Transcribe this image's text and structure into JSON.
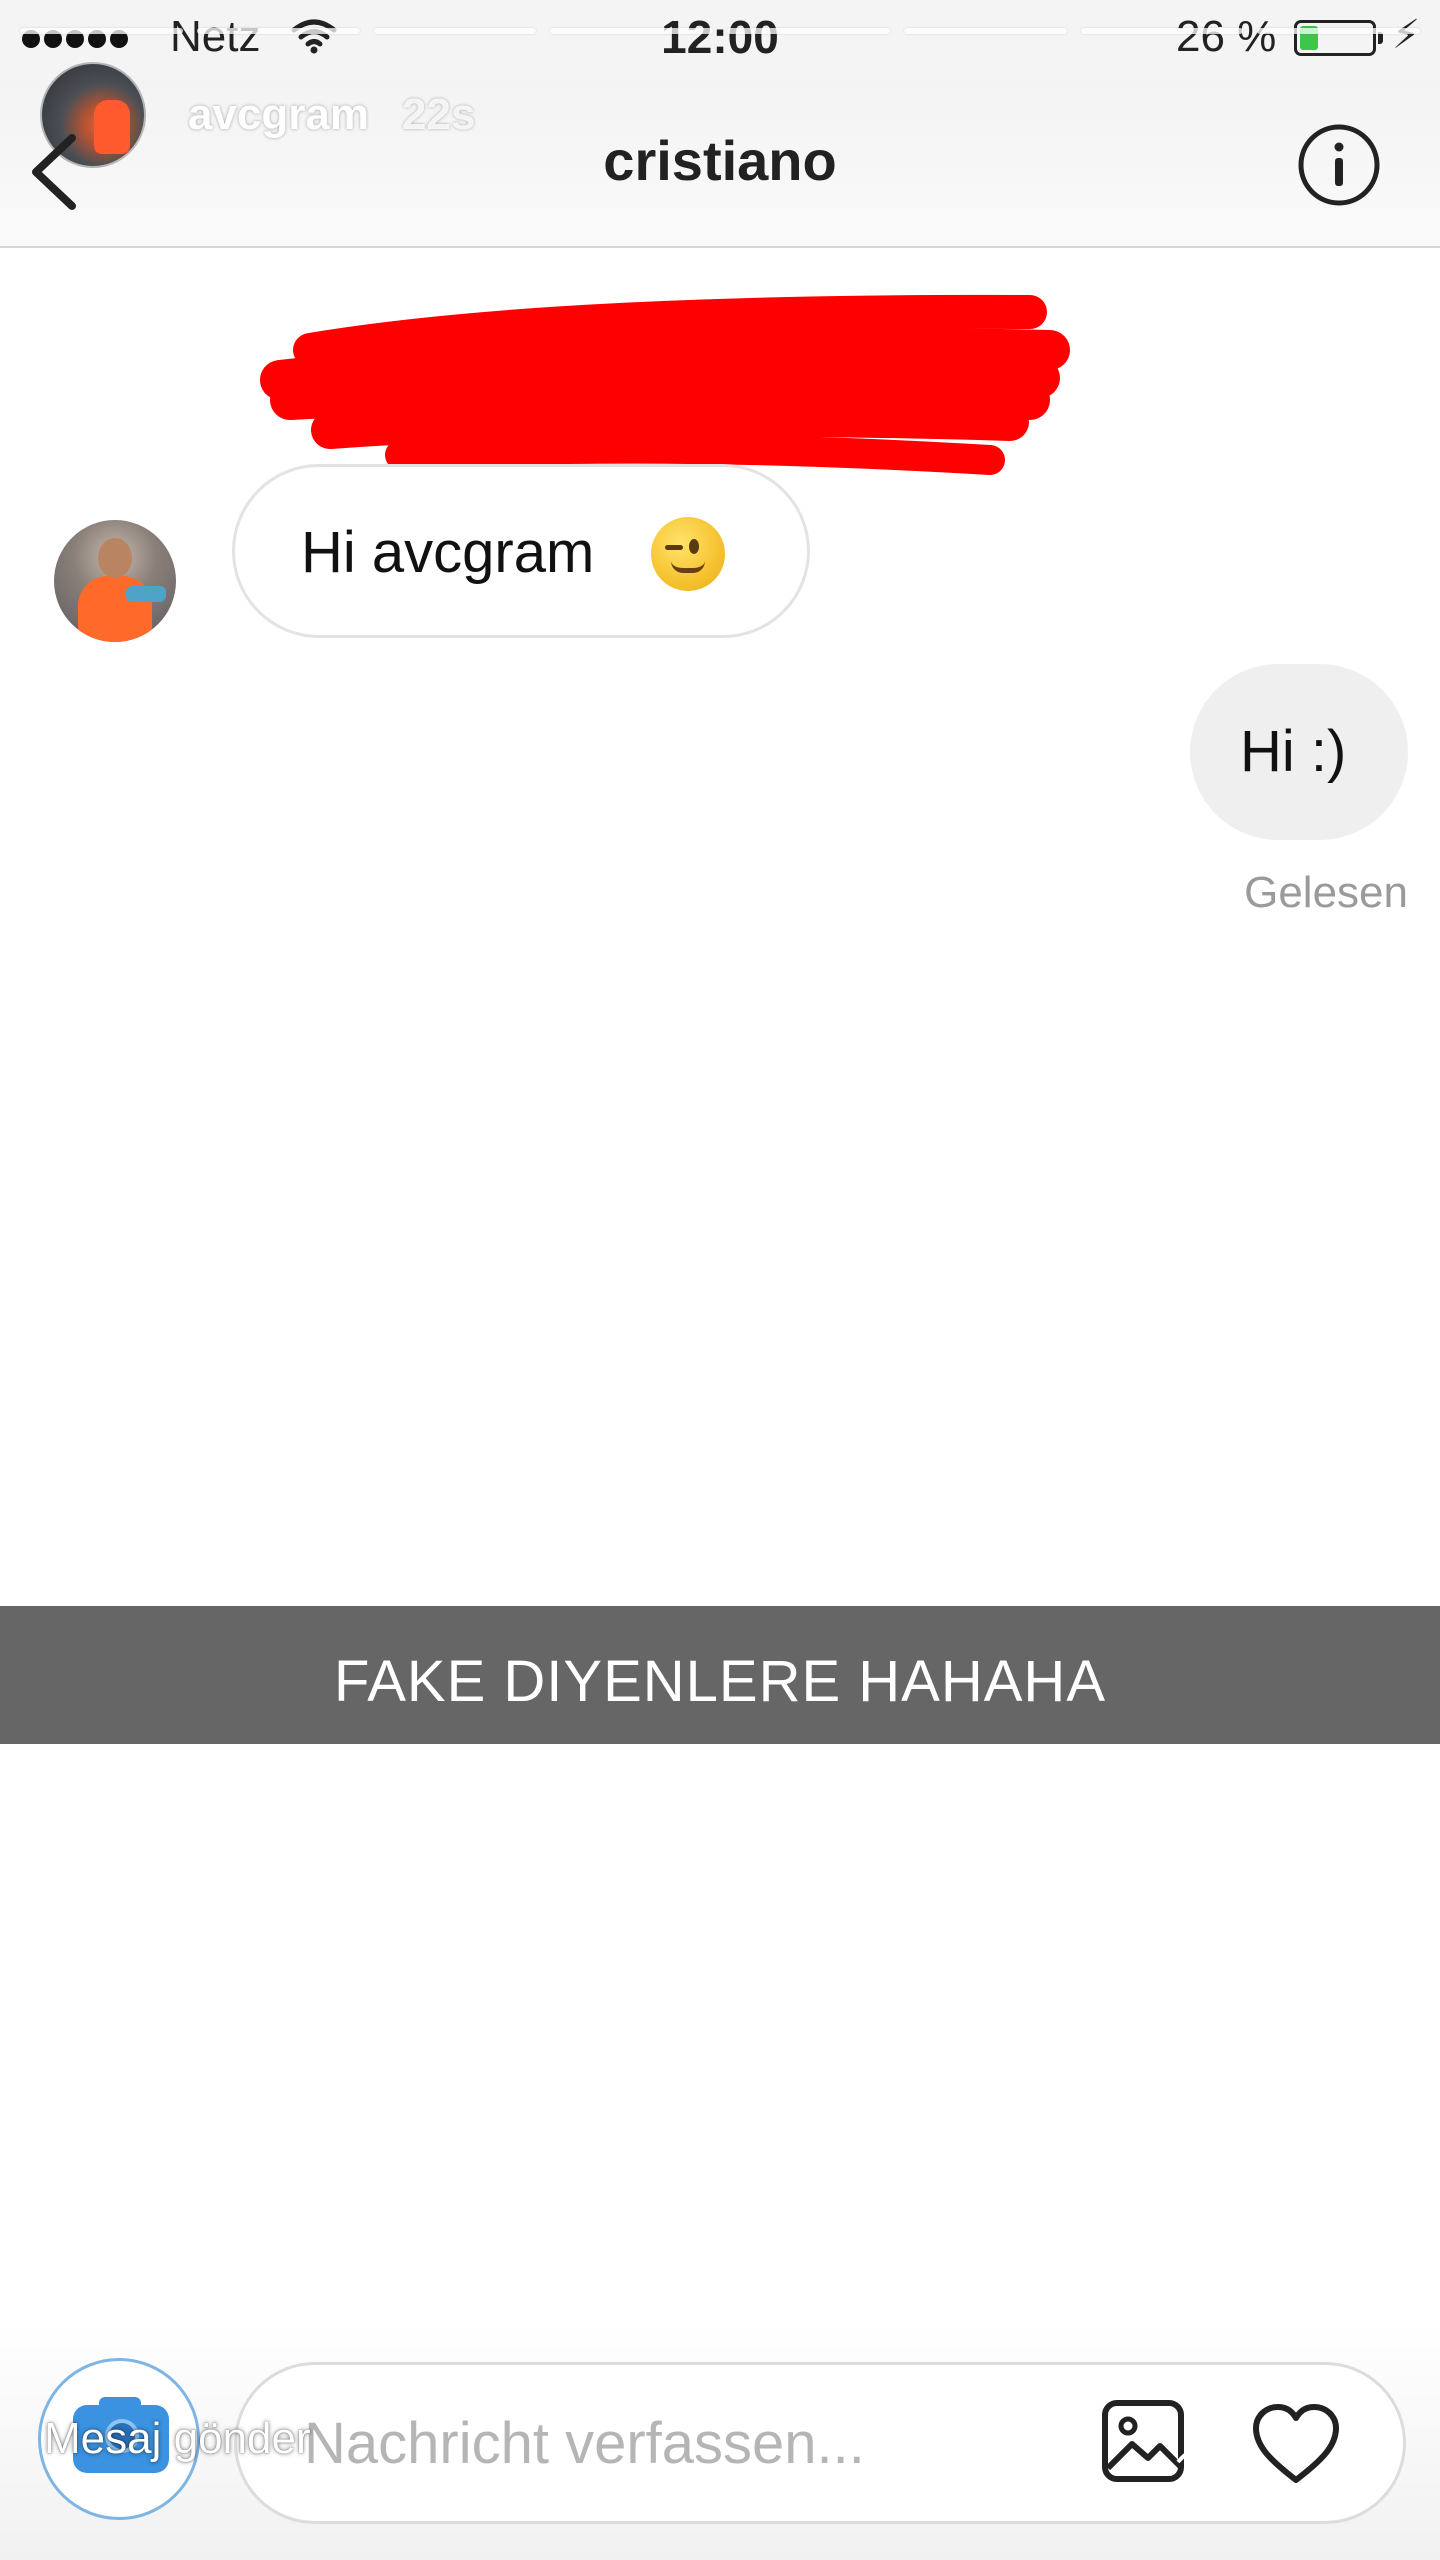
{
  "status_bar": {
    "carrier": "Netz",
    "time": "12:00",
    "battery_percent": "26 %",
    "battery_level": 0.26,
    "battery_color": "#3bc84a"
  },
  "story": {
    "username": "avcgram",
    "elapsed": "22s",
    "progress_segments": 8
  },
  "header": {
    "title": "cristiano",
    "back_icon": "chevron-left-icon",
    "info_icon": "info-circle-icon"
  },
  "messages": [
    {
      "direction": "incoming",
      "text": "Hi avcgram",
      "emoji": "winking-face"
    },
    {
      "direction": "outgoing",
      "text": "Hi :)",
      "status": "Gelesen"
    }
  ],
  "overlay": {
    "caption": "FAKE DIYENLERE HAHAHA",
    "caption_bg": "#666666",
    "redaction_color": "#ff0000"
  },
  "composer": {
    "placeholder": "Nachricht verfassen...",
    "story_reply_label": "Mesaj gönder",
    "camera_icon": "camera-icon",
    "gallery_icon": "image-icon",
    "like_icon": "heart-icon",
    "accent": "#3a92e0"
  }
}
